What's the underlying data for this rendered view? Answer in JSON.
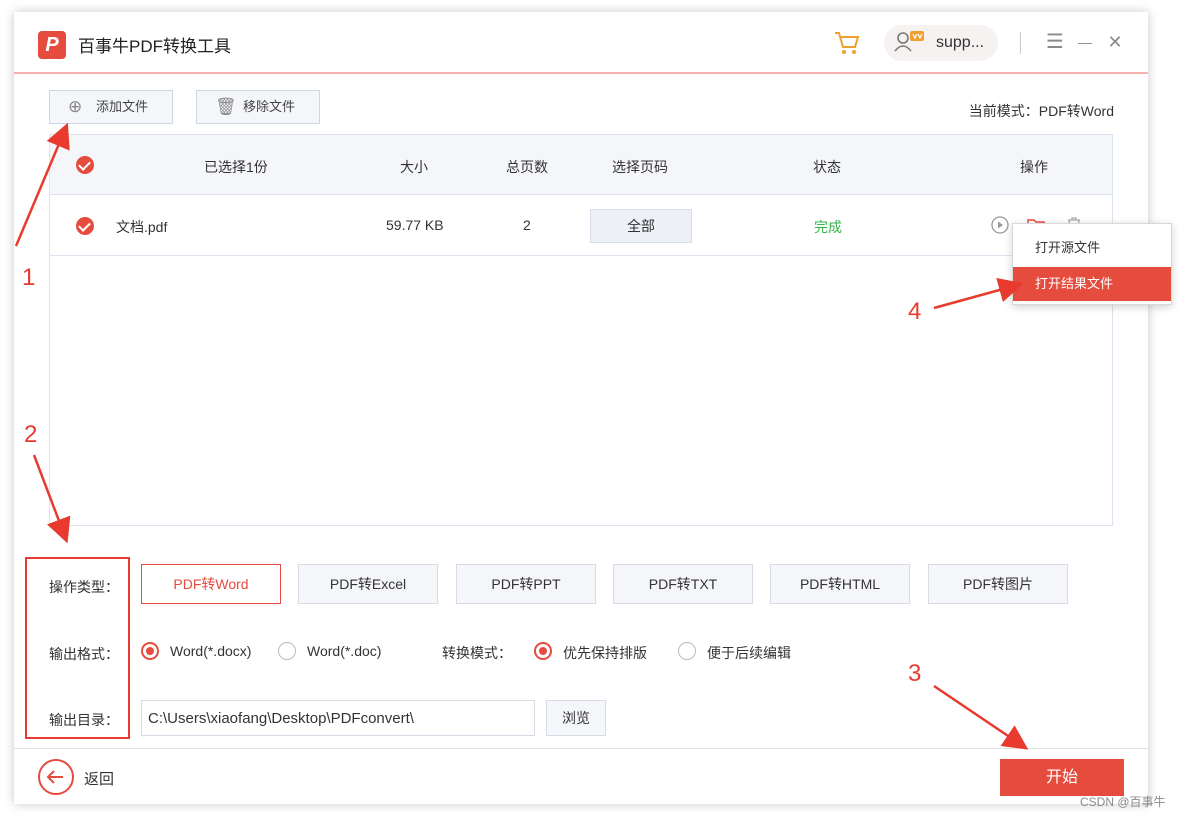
{
  "app": {
    "title": "百事牛PDF转换工具",
    "logo_letter": "P",
    "user_name": "supp...",
    "brand_color": "#e54c3e"
  },
  "window_controls": {
    "menu": "☰",
    "minimize": "—",
    "close": "✕"
  },
  "toolbar": {
    "add_file": "添加文件",
    "remove_file": "移除文件",
    "current_mode": "当前模式：PDF转Word"
  },
  "table": {
    "headers": {
      "selected": "已选择1份",
      "size": "大小",
      "pages": "总页数",
      "page_range": "选择页码",
      "status": "状态",
      "actions": "操作"
    },
    "rows": [
      {
        "name": "文档.pdf",
        "size": "59.77 KB",
        "pages": "2",
        "page_range": "全部",
        "status": "完成"
      }
    ]
  },
  "context_menu": {
    "items": [
      "打开源文件",
      "打开结果文件"
    ]
  },
  "options": {
    "operation_type_label": "操作类型：",
    "conversion_types": [
      "PDF转Word",
      "PDF转Excel",
      "PDF转PPT",
      "PDF转TXT",
      "PDF转HTML",
      "PDF转图片"
    ],
    "output_format_label": "输出格式：",
    "formats": [
      "Word(*.docx)",
      "Word(*.doc)"
    ],
    "conversion_mode_label": "转换模式：",
    "modes": [
      "优先保持排版",
      "便于后续编辑"
    ],
    "output_dir_label": "输出目录：",
    "output_dir": "C:\\Users\\xiaofang\\Desktop\\PDFconvert\\",
    "browse": "浏览"
  },
  "footer": {
    "back": "返回",
    "start": "开始"
  },
  "annotations": {
    "n1": "1",
    "n2": "2",
    "n3": "3",
    "n4": "4",
    "color": "#e83a2e"
  },
  "watermark": "CSDN @百事牛"
}
